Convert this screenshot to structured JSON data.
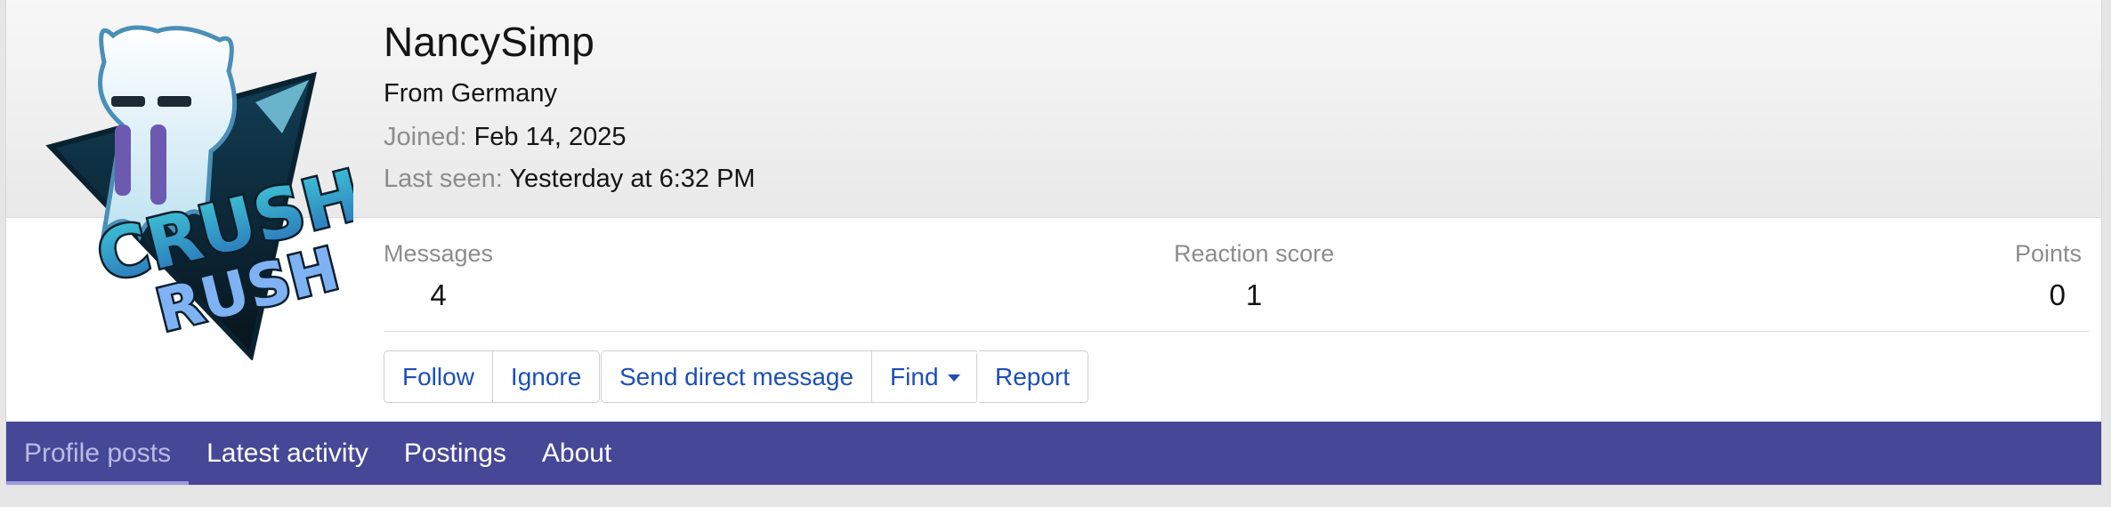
{
  "profile": {
    "username": "NancySimp",
    "location": "From Germany",
    "joined_label": "Joined:",
    "joined_value": "Feb 14, 2025",
    "last_seen_label": "Last seen:",
    "last_seen_value": "Yesterday at 6:32 PM",
    "avatar_icon": "crush-rush-logo-avatar",
    "avatar_text": [
      "CRUSH",
      "RUSH"
    ]
  },
  "stats": {
    "messages_label": "Messages",
    "messages_value": "4",
    "reaction_label": "Reaction score",
    "reaction_value": "1",
    "points_label": "Points",
    "points_value": "0"
  },
  "actions": {
    "follow": "Follow",
    "ignore": "Ignore",
    "send_dm": "Send direct message",
    "find": "Find",
    "report": "Report"
  },
  "tabs": [
    {
      "label": "Profile posts",
      "active": true
    },
    {
      "label": "Latest activity",
      "active": false
    },
    {
      "label": "Postings",
      "active": false
    },
    {
      "label": "About",
      "active": false
    }
  ],
  "colors": {
    "tab_bar": "#464796",
    "link_blue": "#1d4fb8",
    "active_tab_text": "#b9bbe6"
  }
}
